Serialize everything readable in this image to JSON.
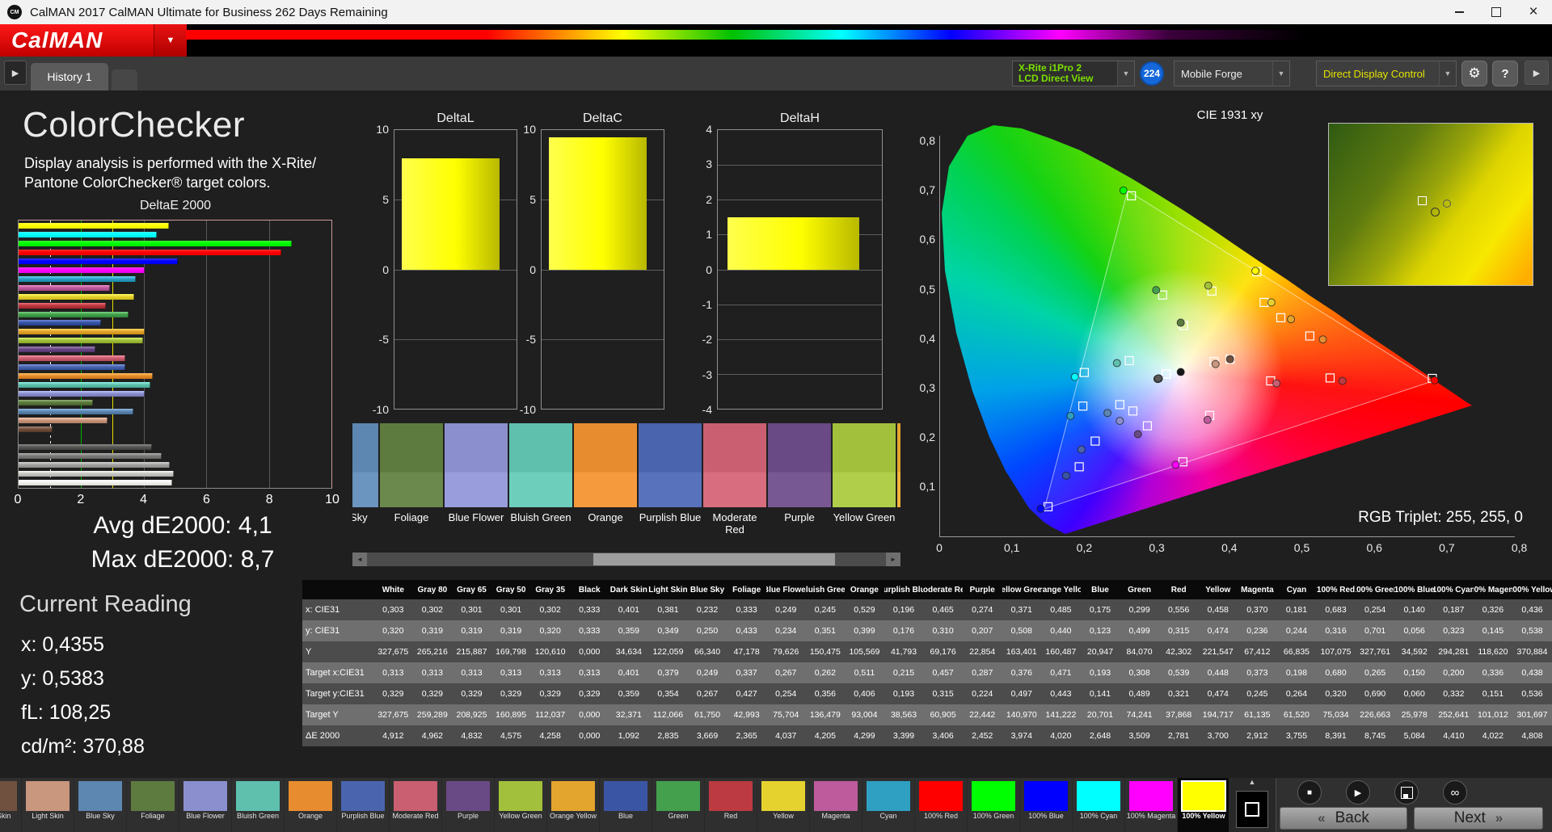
{
  "window": {
    "title": "CalMAN 2017 CalMAN Ultimate for Business 262 Days Remaining"
  },
  "brand": {
    "logo": "CalMAN",
    "icon": "CM"
  },
  "tabs": {
    "history": "History 1"
  },
  "icons": {
    "dropdown": "▼",
    "nav_arrow": "▶",
    "gear": "⚙",
    "help": "?",
    "close": "×",
    "scroll_left": "◄",
    "scroll_right": "►",
    "stop": "■",
    "play": "▶",
    "infinity": "∞",
    "collapse": "▲",
    "back_chev": "«",
    "next_chev": "»"
  },
  "toolbar": {
    "meter_line1": "X-Rite i1Pro 2",
    "meter_line2": "LCD Direct View",
    "badge": "224",
    "source": "Mobile Forge",
    "workflow": "Direct Display Control"
  },
  "left": {
    "title": "ColorChecker",
    "desc1": "Display analysis is performed with the X-Rite/",
    "desc2": "Pantone ColorChecker® target colors.",
    "chart_title": "DeltaE 2000",
    "axis_ticks": [
      "0",
      "2",
      "4",
      "6",
      "8",
      "10"
    ],
    "avg": "Avg dE2000: 4,1",
    "max": "Max dE2000: 8,7",
    "current_reading": "Current Reading",
    "x": "x: 0,4355",
    "y": "y: 0,5383",
    "fl": "fL: 108,25",
    "cd": "cd/m²: 370,88"
  },
  "delta_charts": [
    {
      "title": "DeltaL",
      "min": -10,
      "max": 10,
      "ticks": [
        10,
        5,
        0,
        -5,
        -10
      ],
      "value": 8.0
    },
    {
      "title": "DeltaC",
      "min": -10,
      "max": 10,
      "ticks": [
        10,
        5,
        0,
        -5,
        -10
      ],
      "value": 9.5
    },
    {
      "title": "DeltaH",
      "min": -4,
      "max": 4,
      "ticks": [
        4,
        3,
        2,
        1,
        0,
        -1,
        -2,
        -3,
        -4
      ],
      "value": 1.5
    }
  ],
  "cie": {
    "title": "CIE 1931 xy",
    "rgb_triplet": "RGB Triplet: 255, 255, 0",
    "x_ticks": [
      "0",
      "0,1",
      "0,2",
      "0,3",
      "0,4",
      "0,5",
      "0,6",
      "0,7",
      "0,8"
    ],
    "y_ticks": [
      "0,1",
      "0,2",
      "0,3",
      "0,4",
      "0,5",
      "0,6",
      "0,7",
      "0,8"
    ]
  },
  "table": {
    "rows": [
      {
        "label": "x: CIE31",
        "key": "x"
      },
      {
        "label": "y: CIE31",
        "key": "y"
      },
      {
        "label": "Y",
        "key": "Y"
      },
      {
        "label": "Target x:CIE31",
        "key": "tx"
      },
      {
        "label": "Target y:CIE31",
        "key": "ty"
      },
      {
        "label": "Target Y",
        "key": "tY"
      },
      {
        "label": "ΔE 2000",
        "key": "dE"
      }
    ]
  },
  "patches": [
    {
      "name": "White",
      "color": "#f2f2ef",
      "x": "0,303",
      "y": "0,320",
      "Y": "327,675",
      "tx": "0,313",
      "ty": "0,329",
      "tY": "327,675",
      "dE": "4,912"
    },
    {
      "name": "Gray 80",
      "color": "#c7c7c4",
      "x": "0,302",
      "y": "0,319",
      "Y": "265,216",
      "tx": "0,313",
      "ty": "0,329",
      "tY": "259,289",
      "dE": "4,962"
    },
    {
      "name": "Gray 65",
      "color": "#a3a3a1",
      "x": "0,301",
      "y": "0,319",
      "Y": "215,887",
      "tx": "0,313",
      "ty": "0,329",
      "tY": "208,925",
      "dE": "4,832"
    },
    {
      "name": "Gray 50",
      "color": "#7d7d7b",
      "x": "0,301",
      "y": "0,319",
      "Y": "169,798",
      "tx": "0,313",
      "ty": "0,329",
      "tY": "160,895",
      "dE": "4,575"
    },
    {
      "name": "Gray 35",
      "color": "#585856",
      "x": "0,302",
      "y": "0,320",
      "Y": "120,610",
      "tx": "0,313",
      "ty": "0,329",
      "tY": "112,037",
      "dE": "4,258"
    },
    {
      "name": "Black",
      "color": "#161616",
      "x": "0,333",
      "y": "0,333",
      "Y": "0,000",
      "tx": "0,313",
      "ty": "0,329",
      "tY": "0,000",
      "dE": "0,000"
    },
    {
      "name": "Dark Skin",
      "color": "#70503e",
      "x": "0,401",
      "y": "0,359",
      "Y": "34,634",
      "tx": "0,401",
      "ty": "0,359",
      "tY": "32,371",
      "dE": "1,092"
    },
    {
      "name": "Light Skin",
      "color": "#c9967e",
      "x": "0,381",
      "y": "0,349",
      "Y": "122,059",
      "tx": "0,379",
      "ty": "0,354",
      "tY": "112,066",
      "dE": "2,835"
    },
    {
      "name": "Blue Sky",
      "color": "#5d86b1",
      "x": "0,232",
      "y": "0,250",
      "Y": "66,340",
      "tx": "0,249",
      "ty": "0,267",
      "tY": "61,750",
      "dE": "3,669"
    },
    {
      "name": "Foliage",
      "color": "#5d7b3f",
      "x": "0,333",
      "y": "0,433",
      "Y": "47,178",
      "tx": "0,337",
      "ty": "0,427",
      "tY": "42,993",
      "dE": "2,365"
    },
    {
      "name": "Blue Flower",
      "color": "#8b8fce",
      "x": "0,249",
      "y": "0,234",
      "Y": "79,626",
      "tx": "0,267",
      "ty": "0,254",
      "tY": "75,704",
      "dE": "4,037"
    },
    {
      "name": "Bluish Green",
      "color": "#5fc0ae",
      "x": "0,245",
      "y": "0,351",
      "Y": "150,475",
      "tx": "0,262",
      "ty": "0,356",
      "tY": "136,479",
      "dE": "4,205"
    },
    {
      "name": "Orange",
      "color": "#e78d2f",
      "x": "0,529",
      "y": "0,399",
      "Y": "105,569",
      "tx": "0,511",
      "ty": "0,406",
      "tY": "93,004",
      "dE": "4,299"
    },
    {
      "name": "Purplish Blue",
      "color": "#4a64ae",
      "x": "0,196",
      "y": "0,176",
      "Y": "41,793",
      "tx": "0,215",
      "ty": "0,193",
      "tY": "38,563",
      "dE": "3,399"
    },
    {
      "name": "Moderate Red",
      "color": "#c95f70",
      "x": "0,465",
      "y": "0,310",
      "Y": "69,176",
      "tx": "0,457",
      "ty": "0,315",
      "tY": "60,905",
      "dE": "3,406"
    },
    {
      "name": "Purple",
      "color": "#6a4a85",
      "x": "0,274",
      "y": "0,207",
      "Y": "22,854",
      "tx": "0,287",
      "ty": "0,224",
      "tY": "22,442",
      "dE": "2,452"
    },
    {
      "name": "Yellow Green",
      "color": "#a2c03c",
      "x": "0,371",
      "y": "0,508",
      "Y": "163,401",
      "tx": "0,376",
      "ty": "0,497",
      "tY": "140,970",
      "dE": "3,974"
    },
    {
      "name": "Orange Yellow",
      "color": "#e3a52d",
      "x": "0,485",
      "y": "0,440",
      "Y": "160,487",
      "tx": "0,471",
      "ty": "0,443",
      "tY": "141,222",
      "dE": "4,020"
    },
    {
      "name": "Blue",
      "color": "#3b55a5",
      "x": "0,175",
      "y": "0,123",
      "Y": "20,947",
      "tx": "0,193",
      "ty": "0,141",
      "tY": "20,701",
      "dE": "2,648"
    },
    {
      "name": "Green",
      "color": "#45a04e",
      "x": "0,299",
      "y": "0,499",
      "Y": "84,070",
      "tx": "0,308",
      "ty": "0,489",
      "tY": "74,241",
      "dE": "3,509"
    },
    {
      "name": "Red",
      "color": "#bc3a42",
      "x": "0,556",
      "y": "0,315",
      "Y": "42,302",
      "tx": "0,539",
      "ty": "0,321",
      "tY": "37,868",
      "dE": "2,781"
    },
    {
      "name": "Yellow",
      "color": "#e6d22f",
      "x": "0,458",
      "y": "0,474",
      "Y": "221,547",
      "tx": "0,448",
      "ty": "0,474",
      "tY": "194,717",
      "dE": "3,700"
    },
    {
      "name": "Magenta",
      "color": "#bd5b9c",
      "x": "0,370",
      "y": "0,236",
      "Y": "67,412",
      "tx": "0,373",
      "ty": "0,245",
      "tY": "61,135",
      "dE": "2,912"
    },
    {
      "name": "Cyan",
      "color": "#2f9fc2",
      "x": "0,181",
      "y": "0,244",
      "Y": "66,835",
      "tx": "0,198",
      "ty": "0,264",
      "tY": "61,520",
      "dE": "3,755"
    },
    {
      "name": "100% Red",
      "color": "#ff0000",
      "x": "0,683",
      "y": "0,316",
      "Y": "107,075",
      "tx": "0,680",
      "ty": "0,320",
      "tY": "75,034",
      "dE": "8,391"
    },
    {
      "name": "100% Green",
      "color": "#00ff00",
      "x": "0,254",
      "y": "0,701",
      "Y": "327,761",
      "tx": "0,265",
      "ty": "0,690",
      "tY": "226,663",
      "dE": "8,745"
    },
    {
      "name": "100% Blue",
      "color": "#0000ff",
      "x": "0,140",
      "y": "0,056",
      "Y": "34,592",
      "tx": "0,150",
      "ty": "0,060",
      "tY": "25,978",
      "dE": "5,084"
    },
    {
      "name": "100% Cyan",
      "color": "#00ffff",
      "x": "0,187",
      "y": "0,323",
      "Y": "294,281",
      "tx": "0,200",
      "ty": "0,332",
      "tY": "252,641",
      "dE": "4,410"
    },
    {
      "name": "100% Magenta",
      "color": "#ff00ff",
      "x": "0,326",
      "y": "0,145",
      "Y": "118,620",
      "tx": "0,336",
      "ty": "0,151",
      "tY": "101,012",
      "dE": "4,022"
    },
    {
      "name": "100% Yellow",
      "color": "#ffff00",
      "x": "0,436",
      "y": "0,538",
      "Y": "370,884",
      "tx": "0,438",
      "ty": "0,536",
      "tY": "301,697",
      "dE": "4,808"
    }
  ],
  "de_bar_order": [
    29,
    27,
    25,
    24,
    26,
    28,
    23,
    22,
    21,
    20,
    19,
    18,
    17,
    16,
    15,
    14,
    13,
    12,
    11,
    10,
    9,
    8,
    7,
    6,
    5,
    4,
    3,
    2,
    1,
    0
  ],
  "mid_strip": {
    "start": 8,
    "count": 10
  },
  "bottom": {
    "order": [
      6,
      7,
      8,
      9,
      10,
      11,
      12,
      13,
      14,
      15,
      16,
      17,
      18,
      19,
      20,
      21,
      22,
      23,
      24,
      25,
      26,
      27,
      28,
      29
    ],
    "selected": "100% Yellow",
    "back_label": "Back",
    "next_label": "Next"
  }
}
